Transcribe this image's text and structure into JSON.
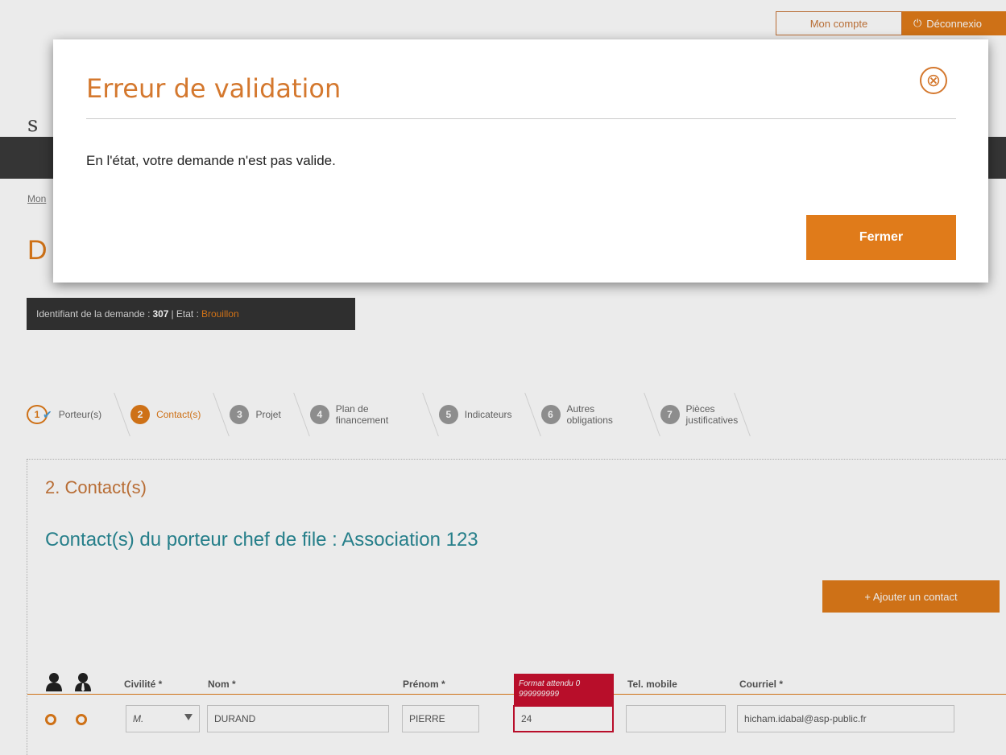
{
  "header": {
    "account_label": "Mon compte",
    "logout_label": "Déconnexio"
  },
  "background": {
    "logo_fragment": "s",
    "breadcrumb_fragment": "Mon",
    "page_title_fragment": "D",
    "request_id_label": "Identifiant de la demande :",
    "request_id": "307",
    "state_label": "| Etat :",
    "state_value": "Brouillon"
  },
  "steps": [
    {
      "num": "1",
      "label": "Porteur(s)",
      "status": "done"
    },
    {
      "num": "2",
      "label": "Contact(s)",
      "status": "active"
    },
    {
      "num": "3",
      "label": "Projet",
      "status": "todo"
    },
    {
      "num": "4",
      "label": "Plan de financement",
      "status": "todo"
    },
    {
      "num": "5",
      "label": "Indicateurs",
      "status": "todo"
    },
    {
      "num": "6",
      "label": "Autres obligations",
      "status": "todo"
    },
    {
      "num": "7",
      "label": "Pièces justificatives",
      "status": "todo"
    }
  ],
  "section": {
    "title": "2. Contact(s)",
    "subtitle": "Contact(s) du porteur chef de file : Association 123",
    "add_contact_label": "+ Ajouter un contact"
  },
  "table": {
    "headers": {
      "civility": "Civilité *",
      "last_name": "Nom *",
      "first_name": "Prénom *",
      "mobile": "Tel. mobile",
      "email": "Courriel *"
    },
    "row": {
      "civility": "M.",
      "last_name": "DURAND",
      "first_name": "PIERRE",
      "phone": "24",
      "mobile": "",
      "email": "hicham.idabal@asp-public.fr"
    },
    "error_tooltip": "Format attendu 0 999999999"
  },
  "modal": {
    "title": "Erreur de validation",
    "message": "En l'état, votre demande n'est pas valide.",
    "close_label": "Fermer"
  },
  "colors": {
    "accent": "#e07b1a",
    "teal": "#2a8a96",
    "error": "#c8102e"
  }
}
